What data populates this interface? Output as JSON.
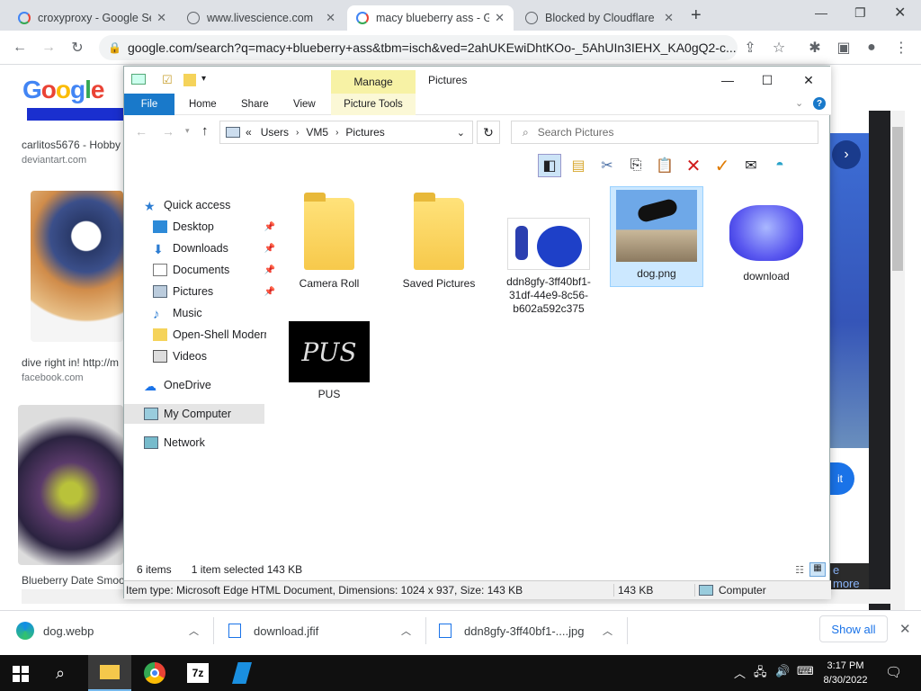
{
  "browser": {
    "tabs": [
      {
        "title": "croxyproxy - Google Se",
        "active": false,
        "icon": "google-icon"
      },
      {
        "title": "www.livescience.com",
        "active": false,
        "icon": "globe-icon"
      },
      {
        "title": "macy blueberry ass - G",
        "active": true,
        "icon": "google-icon"
      },
      {
        "title": "Blocked by Cloudflare",
        "active": false,
        "icon": "globe-icon"
      }
    ],
    "url": "google.com/search?q=macy+blueberry+ass&tbm=isch&ved=2ahUKEwiDhtKOo-_5AhUIn3IEHX_KA0gQ2-c..."
  },
  "google": {
    "logo": "Google",
    "results": [
      {
        "caption": "carlitos5676 - Hobby",
        "source": "deviantart.com"
      },
      {
        "caption": "dive right in! http://m",
        "source": "facebook.com"
      },
      {
        "caption": "Blueberry Date Smoo",
        "source": ""
      }
    ],
    "right_btn": "it",
    "more": "e more"
  },
  "explorer": {
    "ribbon": {
      "manage": "Manage",
      "title": "Pictures",
      "tabs": {
        "file": "File",
        "home": "Home",
        "share": "Share",
        "view": "View",
        "picture_tools": "Picture Tools"
      }
    },
    "address": {
      "users": "Users",
      "vm5": "VM5",
      "pictures": "Pictures",
      "chev": "«"
    },
    "search_placeholder": "Search Pictures",
    "nav": {
      "quick_access": "Quick access",
      "desktop": "Desktop",
      "downloads": "Downloads",
      "documents": "Documents",
      "pictures": "Pictures",
      "music": "Music",
      "open_shell": "Open-Shell Modern",
      "videos": "Videos",
      "onedrive": "OneDrive",
      "my_computer": "My Computer",
      "network": "Network"
    },
    "files": {
      "camera_roll": "Camera Roll",
      "saved_pictures": "Saved Pictures",
      "ddn": "ddn8gfy-3ff40bf1-31df-44e9-8c56-b602a592c375",
      "dog": "dog.png",
      "download": "download",
      "pus": "PUS"
    },
    "status": {
      "items": "6 items",
      "selected": "1 item selected  143 KB"
    },
    "info": {
      "type": "Item type: Microsoft Edge HTML Document, Dimensions: 1024 x 937, Size: 143 KB",
      "size": "143 KB",
      "location": "Computer"
    }
  },
  "downloads": {
    "items": [
      "dog.webp",
      "download.jfif",
      "ddn8gfy-3ff40bf1-....jpg"
    ],
    "show_all": "Show all"
  },
  "taskbar": {
    "time": "3:17 PM",
    "date": "8/30/2022"
  }
}
